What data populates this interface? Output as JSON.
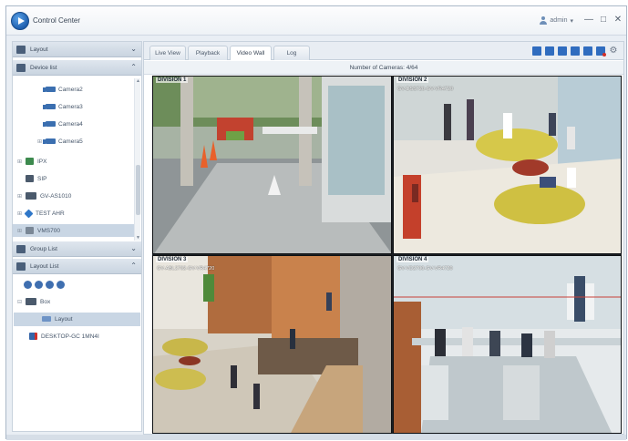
{
  "app": {
    "title": "Control Center",
    "user": "admin",
    "user_caret": "▾",
    "minimize": "—",
    "maximize": "□",
    "close": "✕"
  },
  "left_panel": {
    "sections": [
      {
        "label": "Layout",
        "chevron": "⌄"
      },
      {
        "label": "Device list",
        "chevron": "⌃"
      },
      {
        "label": "Group List",
        "chevron": "⌄"
      },
      {
        "label": "Layout List",
        "chevron": "⌃"
      }
    ],
    "device_tree": [
      {
        "label": "Camera2",
        "expander": ""
      },
      {
        "label": "Camera3",
        "expander": ""
      },
      {
        "label": "Camera4",
        "expander": ""
      },
      {
        "label": "Camera5",
        "expander": "⊞"
      },
      {
        "label": "IPX",
        "expander": "⊞"
      },
      {
        "label": "SIP",
        "expander": ""
      },
      {
        "label": "GV-AS1010",
        "expander": "⊞"
      },
      {
        "label": "TEST AHR",
        "expander": "⊞"
      },
      {
        "label": "VMS700",
        "expander": "⊞"
      }
    ],
    "layout_tree": [
      {
        "label": "Box",
        "expander": "⊟"
      },
      {
        "label": "Layout",
        "expander": ""
      },
      {
        "label": "DESKTOP-GC 1MN4I",
        "expander": ""
      }
    ],
    "scroll_up": "▲",
    "scroll_down": "▼"
  },
  "main": {
    "tabs": [
      {
        "label": "Live View"
      },
      {
        "label": "Playback"
      },
      {
        "label": "Video Wall"
      },
      {
        "label": "Log"
      }
    ],
    "active_tab": "Video Wall",
    "camera_count": "Number of Cameras: 4/64",
    "gear": "⚙",
    "divisions": [
      {
        "title": "DIVISION 1",
        "camera": ""
      },
      {
        "title": "DIVISION 2",
        "camera": "GV-DSS720-GV-VR4720"
      },
      {
        "title": "DIVISION 3",
        "camera": "GV-ABL2702-GV-VR4720"
      },
      {
        "title": "DIVISION 4",
        "camera": "GV-VD2700-GV-VR4720"
      }
    ]
  },
  "colors": {
    "accent": "#2f6cbf",
    "header": "#c9d4e0",
    "selection": "#c9d6e4",
    "record": "#d0302a"
  }
}
